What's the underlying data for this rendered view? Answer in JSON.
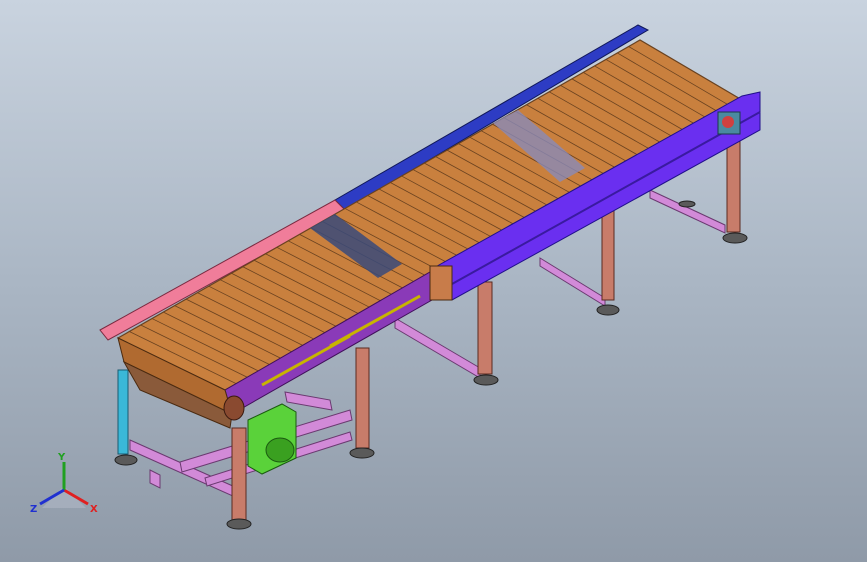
{
  "viewport": {
    "background_top": "#c9d3df",
    "background_bottom": "#8f9aa8"
  },
  "model": {
    "slat_color": "#c9803e",
    "slat_line_color": "#6a4220",
    "frame_back_color": "#2d3cc4",
    "frame_front_color": "#6a2ff0",
    "frame_left_rail_color": "#f07d9a",
    "leg_color": "#c87c6a",
    "brace_color": "#d28ad8",
    "motor_color": "#5ad23a",
    "foot_color": "#6a6a6a",
    "cyan_post_color": "#3ab8d8"
  },
  "triad": {
    "x_label": "X",
    "y_label": "Y",
    "z_label": "Z",
    "x_color": "#e02020",
    "y_color": "#20a020",
    "z_color": "#2030d0"
  }
}
